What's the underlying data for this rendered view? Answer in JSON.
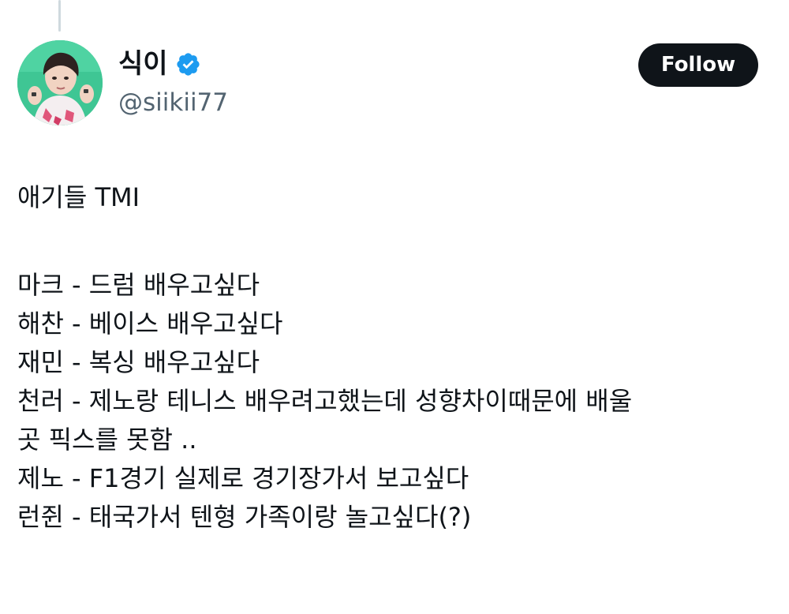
{
  "author": {
    "display_name": "식이",
    "handle": "@siikii77",
    "verified": true,
    "avatar_icon": "user-avatar",
    "verified_icon": "verified-badge-icon",
    "colors": {
      "verified": "#1d9bf0",
      "handle": "#536471",
      "avatar_bg": "#3fc694"
    }
  },
  "follow_button": {
    "label": "Follow",
    "bg_color": "#0f1419"
  },
  "tweet": {
    "lines": [
      "애기들 TMI",
      "",
      "마크 - 드럼 배우고싶다",
      "해찬 - 베이스 배우고싶다",
      "재민 - 복싱 배우고싶다",
      "천러 - 제노랑 테니스 배우려고했는데 성향차이때문에 배울",
      "곳 픽스를 못함 ..",
      "제노 - F1경기 실제로 경기장가서 보고싶다",
      "런쥔 - 태국가서 텐형 가족이랑 놀고싶다(?)"
    ]
  }
}
